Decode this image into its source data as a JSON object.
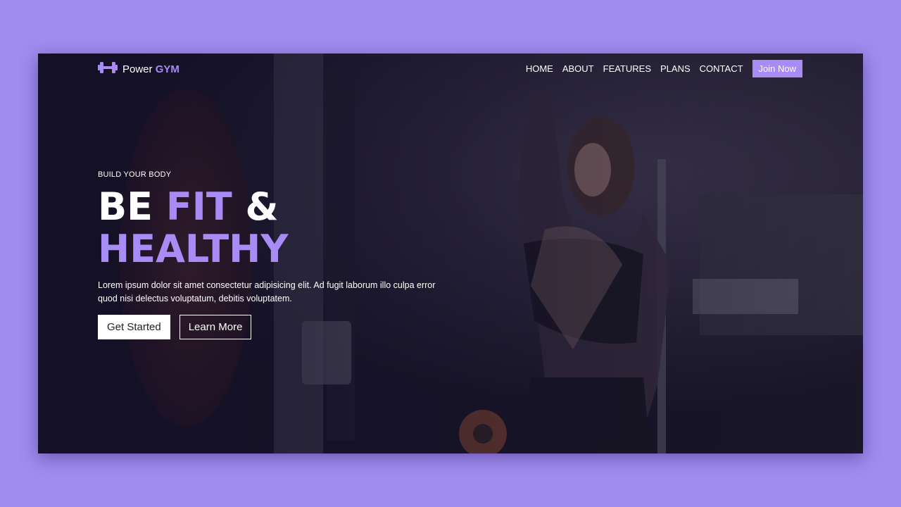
{
  "brand": {
    "name_part1": "Power",
    "name_part2": "GYM",
    "accent_color": "#a88bf5"
  },
  "nav": {
    "items": [
      "HOME",
      "ABOUT",
      "FEATURES",
      "PLANS",
      "CONTACT"
    ],
    "cta_label": "Join Now"
  },
  "hero": {
    "eyebrow": "BUILD YOUR BODY",
    "headline_word1": "BE",
    "headline_word2": "FIT",
    "headline_word3": "&",
    "headline_line2": "HEALTHY",
    "description": "Lorem ipsum dolor sit amet consectetur adipisicing elit. Ad fugit laborum illo culpa error quod nisi delectus voluptatum, debitis voluptatem.",
    "primary_button": "Get Started",
    "secondary_button": "Learn More"
  },
  "icons": {
    "logo": "dumbbell-icon"
  },
  "colors": {
    "page_background": "#a08cef",
    "accent": "#a88bf5"
  }
}
